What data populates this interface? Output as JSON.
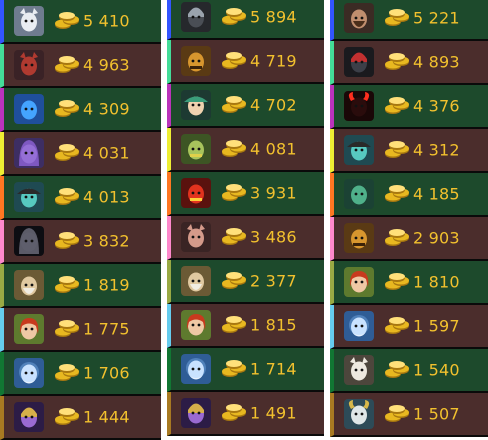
{
  "columns": [
    {
      "players": [
        {
          "hero_icon": "white-wolf-icon",
          "bar_color": "#3355ff",
          "gold": "5 410"
        },
        {
          "hero_icon": "red-ursa-icon",
          "bar_color": "#44dd99",
          "gold": "4 963"
        },
        {
          "hero_icon": "blue-morphling-icon",
          "bar_color": "#bb33bb",
          "gold": "4 309"
        },
        {
          "hero_icon": "purple-mage-icon",
          "bar_color": "#eeee33",
          "gold": "4 031"
        },
        {
          "hero_icon": "teal-hat-icon",
          "bar_color": "#ff7722",
          "gold": "4 013"
        },
        {
          "hero_icon": "dark-hooded-icon",
          "bar_color": "#ff88cc",
          "gold": "3 832"
        },
        {
          "hero_icon": "old-sage-icon",
          "bar_color": "#99aa44",
          "gold": "1 819"
        },
        {
          "hero_icon": "red-hair-icon",
          "bar_color": "#66ccee",
          "gold": "1 775"
        },
        {
          "hero_icon": "ice-skull-icon",
          "bar_color": "#117733",
          "gold": "1 706"
        },
        {
          "hero_icon": "purple-armor-icon",
          "bar_color": "#a87a22",
          "gold": "1 444"
        }
      ]
    },
    {
      "players": [
        {
          "hero_icon": "dark-knight-icon",
          "bar_color": "#3355ff",
          "gold": "5 894"
        },
        {
          "hero_icon": "orange-totem-icon",
          "bar_color": "#44dd99",
          "gold": "4 719"
        },
        {
          "hero_icon": "green-hat-icon",
          "bar_color": "#bb33bb",
          "gold": "4 702"
        },
        {
          "hero_icon": "green-tiki-icon",
          "bar_color": "#eeee33",
          "gold": "4 081"
        },
        {
          "hero_icon": "red-demon-icon",
          "bar_color": "#ff7722",
          "gold": "3 931"
        },
        {
          "hero_icon": "pink-beast-icon",
          "bar_color": "#ff88cc",
          "gold": "3 486"
        },
        {
          "hero_icon": "old-sage-icon",
          "bar_color": "#99aa44",
          "gold": "2 377"
        },
        {
          "hero_icon": "red-hair-icon",
          "bar_color": "#66ccee",
          "gold": "1 815"
        },
        {
          "hero_icon": "ice-skull-icon",
          "bar_color": "#117733",
          "gold": "1 714"
        },
        {
          "hero_icon": "purple-armor-icon",
          "bar_color": "#a87a22",
          "gold": "1 491"
        }
      ]
    },
    {
      "players": [
        {
          "hero_icon": "bearded-warrior-icon",
          "bar_color": "#3355ff",
          "gold": "5 221"
        },
        {
          "hero_icon": "dark-helm-icon",
          "bar_color": "#44dd99",
          "gold": "4 893"
        },
        {
          "hero_icon": "red-shadow-icon",
          "bar_color": "#bb33bb",
          "gold": "4 376"
        },
        {
          "hero_icon": "teal-hat-icon",
          "bar_color": "#eeee33",
          "gold": "4 312"
        },
        {
          "hero_icon": "green-tidehunter-icon",
          "bar_color": "#ff7722",
          "gold": "4 185"
        },
        {
          "hero_icon": "orange-totem-icon",
          "bar_color": "#ff88cc",
          "gold": "2 903"
        },
        {
          "hero_icon": "red-hair-icon",
          "bar_color": "#99aa44",
          "gold": "1 810"
        },
        {
          "hero_icon": "ice-skull-icon",
          "bar_color": "#66ccee",
          "gold": "1 597"
        },
        {
          "hero_icon": "white-beast-icon",
          "bar_color": "#117733",
          "gold": "1 540"
        },
        {
          "hero_icon": "white-horned-icon",
          "bar_color": "#a87a22",
          "gold": "1 507"
        }
      ]
    }
  ],
  "colors": {
    "row_green": "#1d4a2c",
    "row_red": "#4b2d2c",
    "gold_text": "#f2c12e",
    "coin": "#e8b820"
  }
}
